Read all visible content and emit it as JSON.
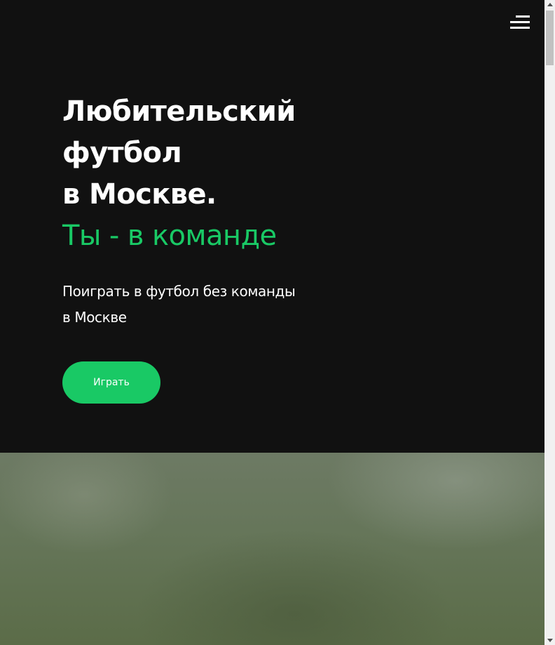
{
  "header": {
    "menu_icon": "hamburger-menu-icon"
  },
  "hero": {
    "title_lines": [
      "Любительский",
      "футбол",
      "в Москве."
    ],
    "title_accent": "Ты - в команде",
    "subtitle_line1": "Поиграть в футбол без команды",
    "subtitle_line2": "в Москве",
    "cta_label": "Играть"
  },
  "colors": {
    "background": "#111111",
    "accent": "#19c965",
    "text": "#ffffff"
  }
}
